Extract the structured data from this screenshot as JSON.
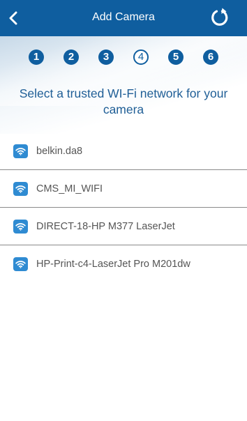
{
  "app_bar": {
    "title": "Add Camera",
    "back_icon": "chevron-left-icon",
    "refresh_icon": "refresh-icon"
  },
  "steps": {
    "items": [
      "1",
      "2",
      "3",
      "4",
      "5",
      "6"
    ],
    "current": "4"
  },
  "instruction": "Select a trusted WI-Fi network for your camera",
  "networks": [
    {
      "name": "belkin.da8",
      "icon": "wifi-icon"
    },
    {
      "name": "CMS_MI_WIFI",
      "icon": "wifi-icon"
    },
    {
      "name": "DIRECT-18-HP M377 LaserJet",
      "icon": "wifi-icon"
    },
    {
      "name": "HP-Print-c4-LaserJet Pro M201dw",
      "icon": "wifi-icon"
    }
  ],
  "colors": {
    "app_bar": "#0f5e9f",
    "step_badge": "#0f5e9f",
    "instruction_text": "#1f5e96",
    "wifi_icon_bg": "#2f8bd2",
    "network_text": "#555555",
    "divider": "#8a8a8a"
  }
}
